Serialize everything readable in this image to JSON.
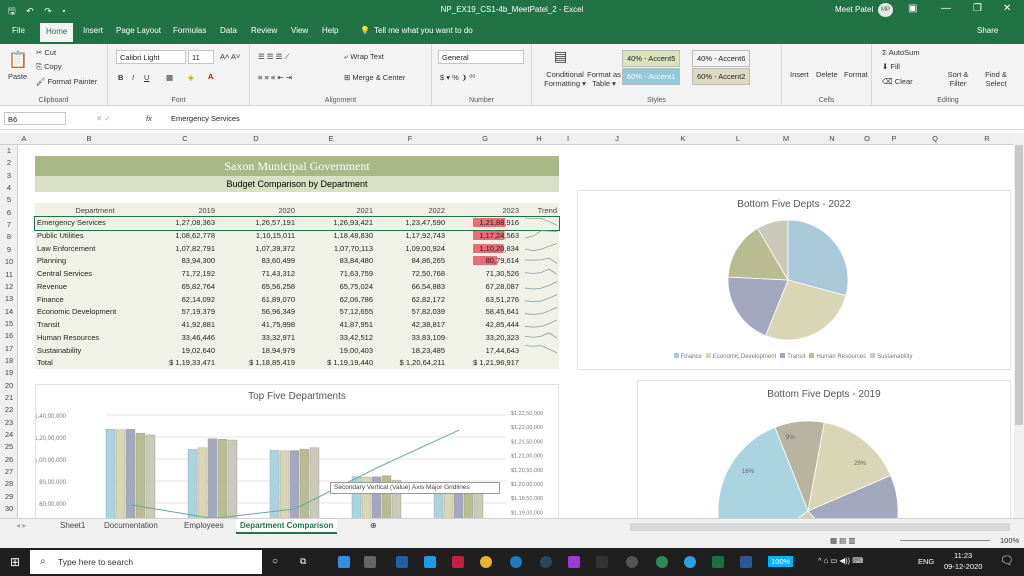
{
  "window": {
    "title": "NP_EX19_CS1-4b_MeetPatel_2  -  Excel",
    "user": "Meet Patel",
    "initials": "MP",
    "qa": "🖫 ↶ ↷ ▾"
  },
  "ribbon_tabs": [
    "File",
    "Home",
    "Insert",
    "Page Layout",
    "Formulas",
    "Data",
    "Review",
    "View",
    "Help",
    "Tell me what you want to do",
    "Share"
  ],
  "ribbon": {
    "clipboard": {
      "paste": "Paste",
      "cut": "Cut",
      "copy": "Copy",
      "painter": "Format Painter",
      "label": "Clipboard"
    },
    "font": {
      "name": "Calibri Light",
      "size": "11",
      "label": "Font"
    },
    "alignment": {
      "wrap": "Wrap Text",
      "merge": "Merge & Center",
      "label": "Alignment"
    },
    "number": {
      "format": "General",
      "label": "Number",
      "symbols": "$ ▾ %  ❩  ⁰⁰"
    },
    "styles": {
      "cond": "Conditional Formatting ▾",
      "fmt_table": "Format as Table ▾",
      "s1": "40% - Accent5",
      "s2": "40% - Accent6",
      "s3": "60% - Accent1",
      "s4": "60% - Accent2",
      "label": "Styles"
    },
    "cells": {
      "insert": "Insert",
      "delete": "Delete",
      "format": "Format",
      "label": "Cells"
    },
    "editing": {
      "autosum": "AutoSum",
      "fill": "Fill",
      "clear": "Clear",
      "sort": "Sort & Filter",
      "find": "Find & Select",
      "label": "Editing"
    }
  },
  "formula_bar": {
    "name_box": "B6",
    "fx": "fx",
    "value": "Emergency Services"
  },
  "columns": [
    "A",
    "B",
    "C",
    "D",
    "E",
    "F",
    "G",
    "H",
    "I",
    "J",
    "K",
    "L",
    "M",
    "N",
    "O",
    "P",
    "Q",
    "R"
  ],
  "rows": [
    "1",
    "2",
    "3",
    "4",
    "5",
    "6",
    "7",
    "8",
    "9",
    "10",
    "11",
    "12",
    "13",
    "14",
    "15",
    "16",
    "17",
    "18",
    "19",
    "20",
    "21",
    "22",
    "23",
    "24",
    "25",
    "26",
    "27",
    "28",
    "29",
    "30"
  ],
  "sheet": {
    "title": "Saxon Municipal Government",
    "subtitle": "Budget Comparison by Department",
    "headers": [
      "Department",
      "2019",
      "2020",
      "2021",
      "2022",
      "2023",
      "Trend"
    ],
    "rows": [
      {
        "dept": "Emergency Services",
        "v": [
          "1,27,08,363",
          "1,26,57,191",
          "1,26,93,421",
          "1,23,47,590",
          "1,21,88,916"
        ],
        "trend": [
          5,
          4.5,
          4.8,
          3,
          1
        ]
      },
      {
        "dept": "Public Utilities",
        "v": [
          "1,08,62,778",
          "1,10,15,011",
          "1,18,48,830",
          "1,17,92,743",
          "1,17,24,563"
        ],
        "trend": [
          1,
          2,
          5,
          4.8,
          4.5
        ]
      },
      {
        "dept": "Law Enforcement",
        "v": [
          "1,07,82,791",
          "1,07,39,372",
          "1,07,70,113",
          "1,09,00,924",
          "1,10,20,834"
        ],
        "trend": [
          2,
          1,
          1.8,
          3.5,
          5
        ]
      },
      {
        "dept": "Planning",
        "v": [
          "83,94,300",
          "83,60,499",
          "83,84,480",
          "84,86,265",
          "80,79,614"
        ],
        "trend": [
          3,
          2.8,
          3,
          4,
          1
        ]
      },
      {
        "dept": "Central Services",
        "v": [
          "71,72,192",
          "71,43,312",
          "71,63,759",
          "72,50,768",
          "71,30,526"
        ],
        "trend": [
          3,
          2.5,
          3,
          5,
          2
        ]
      },
      {
        "dept": "Revenue",
        "v": [
          "65,82,764",
          "65,56,258",
          "65,75,024",
          "66,54,883",
          "67,28,087"
        ],
        "trend": [
          1.5,
          1,
          1.4,
          3,
          5
        ]
      },
      {
        "dept": "Finance",
        "v": [
          "62,14,092",
          "61,89,070",
          "62,06,786",
          "62,82,172",
          "63,51,276"
        ],
        "trend": [
          1.5,
          1,
          1.4,
          3,
          5
        ]
      },
      {
        "dept": "Economic Development",
        "v": [
          "57,19,379",
          "56,96,349",
          "57,12,655",
          "57,82,039",
          "58,45,641"
        ],
        "trend": [
          1.5,
          1,
          1.4,
          3,
          5
        ]
      },
      {
        "dept": "Transit",
        "v": [
          "41,92,881",
          "41,75,998",
          "41,87,951",
          "42,38,817",
          "42,85,444"
        ],
        "trend": [
          1.5,
          1,
          1.4,
          3,
          5
        ]
      },
      {
        "dept": "Human Resources",
        "v": [
          "33,46,446",
          "33,32,971",
          "33,42,512",
          "33,83,109",
          "33,20,323"
        ],
        "trend": [
          3,
          2.5,
          3,
          5,
          2
        ]
      },
      {
        "dept": "Sustainability",
        "v": [
          "19,02,640",
          "18,94,979",
          "19,00,403",
          "18,23,485",
          "17,44,643"
        ],
        "trend": [
          5,
          4.6,
          4.9,
          3,
          1
        ]
      },
      {
        "dept": "Total",
        "v": [
          "$ 1,19,33,471",
          "$ 1,18,85,419",
          "$ 1,19,19,440",
          "$ 1,20,64,211",
          "$ 1,21,96,917"
        ],
        "trend": []
      }
    ]
  },
  "chart_bottom_2022": {
    "title": "Bottom Five Depts - 2022",
    "legend": [
      "Finance",
      "Economic Development",
      "Transit",
      "Human Resources",
      "Sustainability"
    ],
    "colors": [
      "#a9c8d8",
      "#d8d6b4",
      "#a3a8bf",
      "#b7bd90",
      "#c9cab8"
    ]
  },
  "chart_top_five": {
    "title": "Top Five Departments",
    "left_ticks": [
      "1,40,00,000",
      "1,20,00,000",
      "1,00,00,000",
      "80,00,000",
      "60,00,000"
    ],
    "right_ticks": [
      "$1,22,50,000",
      "$1,22,00,000",
      "$1,21,50,000",
      "$1,21,00,000",
      "$1,20,50,000",
      "$1,20,00,000",
      "$1,19,50,000",
      "$1,19,00,000"
    ],
    "tooltip": "Secondary Vertical (Value) Axis Major Gridlines",
    "colors": [
      "#a9d4e0",
      "#d8d6b4",
      "#a3a8bf",
      "#b7bd90",
      "#c9cab8"
    ]
  },
  "chart_bottom_2019": {
    "title": "Bottom Five Depts - 2019",
    "labels": [
      "9%",
      "16%",
      "29%"
    ]
  },
  "chart_data": [
    {
      "type": "pie",
      "title": "Bottom Five Depts - 2022",
      "categories": [
        "Finance",
        "Economic Development",
        "Transit",
        "Human Resources",
        "Sustainability"
      ],
      "values": [
        6282172,
        5782039,
        4238817,
        3383109,
        1823485
      ]
    },
    {
      "type": "bar",
      "title": "Top Five Departments",
      "series": [
        {
          "name": "2019",
          "values": [
            12708363,
            10862778,
            10782791,
            8394300,
            7172192
          ]
        },
        {
          "name": "2020",
          "values": [
            12657191,
            11015011,
            10739372,
            8360499,
            7143312
          ]
        },
        {
          "name": "2021",
          "values": [
            12693421,
            11848830,
            10770113,
            8384480,
            7163759
          ]
        },
        {
          "name": "2022",
          "values": [
            12347590,
            11792743,
            10900924,
            8486265,
            7250768
          ]
        },
        {
          "name": "2023",
          "values": [
            12188916,
            11724563,
            11020834,
            8079614,
            7130526
          ]
        },
        {
          "name": "Total",
          "values": [
            11933471,
            11885419,
            11919440,
            12064211,
            12196917
          ]
        }
      ],
      "ylim": [
        40,
        140
      ]
    },
    {
      "type": "pie",
      "title": "Bottom Five Depts - 2019",
      "categories": [
        "Finance",
        "Economic Development",
        "Transit",
        "Human Resources",
        "Sustainability"
      ],
      "values": [
        6214092,
        5719379,
        4192881,
        3346446,
        1902640
      ],
      "data_labels": [
        "29%",
        "16%",
        "9%"
      ]
    }
  ],
  "sheet_tabs": [
    "Sheet1",
    "Documentation",
    "Employees",
    "Department Comparison"
  ],
  "status": {
    "zoom": "100%"
  },
  "taskbar": {
    "search": "Type here to search",
    "time": "11:23",
    "date": "09-12-2020",
    "lang": "ENG",
    "badge": "100%"
  }
}
